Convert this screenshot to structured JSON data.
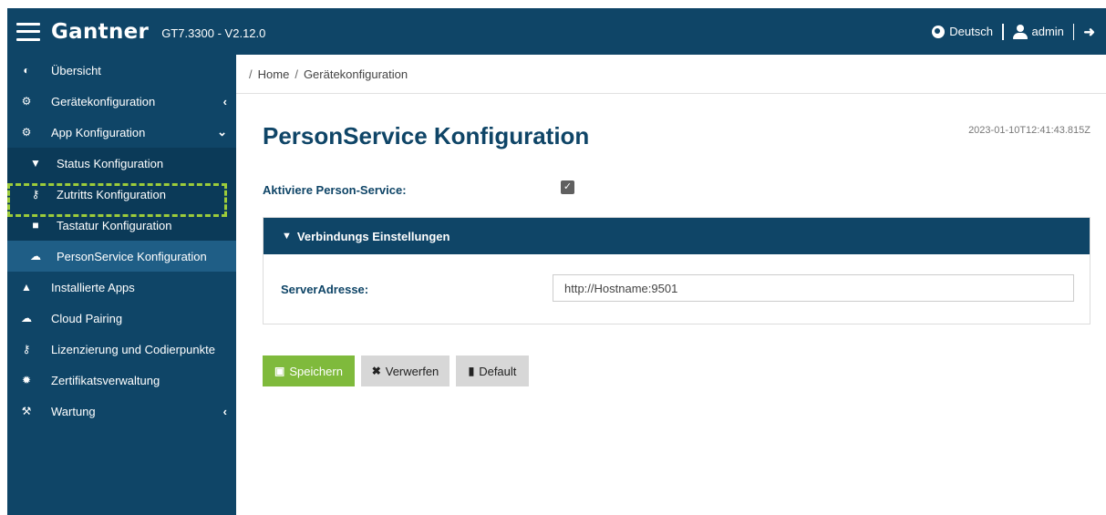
{
  "header": {
    "brand": "Gantner",
    "version": "GT7.3300 - V2.12.0",
    "language": "Deutsch",
    "user": "admin",
    "color": "#0f4567"
  },
  "sidebar": {
    "items": [
      {
        "label": "Übersicht",
        "icon": "pie-chart-icon"
      },
      {
        "label": "Gerätekonfiguration",
        "icon": "gear-icon"
      },
      {
        "label": "App Konfiguration",
        "icon": "gears-icon"
      }
    ],
    "subitems": [
      {
        "label": "Status Konfiguration",
        "icon": "filter-icon"
      },
      {
        "label": "Zutritts Konfiguration",
        "icon": "key-icon"
      },
      {
        "label": "Tastatur Konfiguration",
        "icon": "lock-icon"
      },
      {
        "label": "PersonService Konfiguration",
        "icon": "cloud-icon",
        "active": true
      }
    ],
    "items2": [
      {
        "label": "Installierte Apps",
        "icon": "puzzle-icon"
      },
      {
        "label": "Cloud Pairing",
        "icon": "cloud-icon"
      },
      {
        "label": "Lizenzierung und Codierpunkte",
        "icon": "key-icon"
      },
      {
        "label": "Zertifikatsverwaltung",
        "icon": "certificate-icon"
      },
      {
        "label": "Wartung",
        "icon": "wrench-icon"
      }
    ]
  },
  "breadcrumb": {
    "home": "Home",
    "current": "Gerätekonfiguration"
  },
  "main": {
    "title": "PersonService Konfiguration",
    "timestamp": "2023-01-10T12:41:43.815Z",
    "enable_label": "Aktiviere Person-Service:",
    "enable_checked": true,
    "panel_title": "Verbindungs Einstellungen",
    "server_label": "ServerAdresse:",
    "server_value": "http://Hostname:9501"
  },
  "buttons": {
    "save": "Speichern",
    "discard": "Verwerfen",
    "default": "Default"
  }
}
